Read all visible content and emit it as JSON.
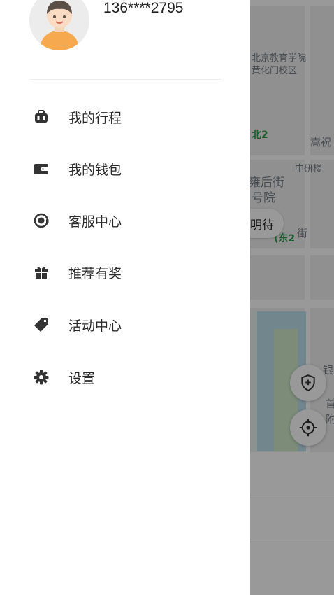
{
  "user": {
    "phone": "136****2795"
  },
  "menu": [
    {
      "label": "我的行程",
      "icon": "trip-icon"
    },
    {
      "label": "我的钱包",
      "icon": "wallet-icon"
    },
    {
      "label": "客服中心",
      "icon": "customer-service-icon"
    },
    {
      "label": "推荐有奖",
      "icon": "gift-icon"
    },
    {
      "label": "活动中心",
      "icon": "tag-icon"
    },
    {
      "label": "设置",
      "icon": "gear-icon"
    }
  ],
  "map": {
    "labels": [
      "北京教育学院",
      "黄化门校区",
      "北2",
      "嵩祝",
      "中研楼",
      "雍后街",
      "号院",
      "(东2",
      "街",
      "银",
      "首",
      "附"
    ],
    "pill_text": "明待"
  },
  "colors": {
    "icon": "#333333",
    "text": "#2a2a2a",
    "overlay": "rgba(0,0,0,0.4)"
  }
}
